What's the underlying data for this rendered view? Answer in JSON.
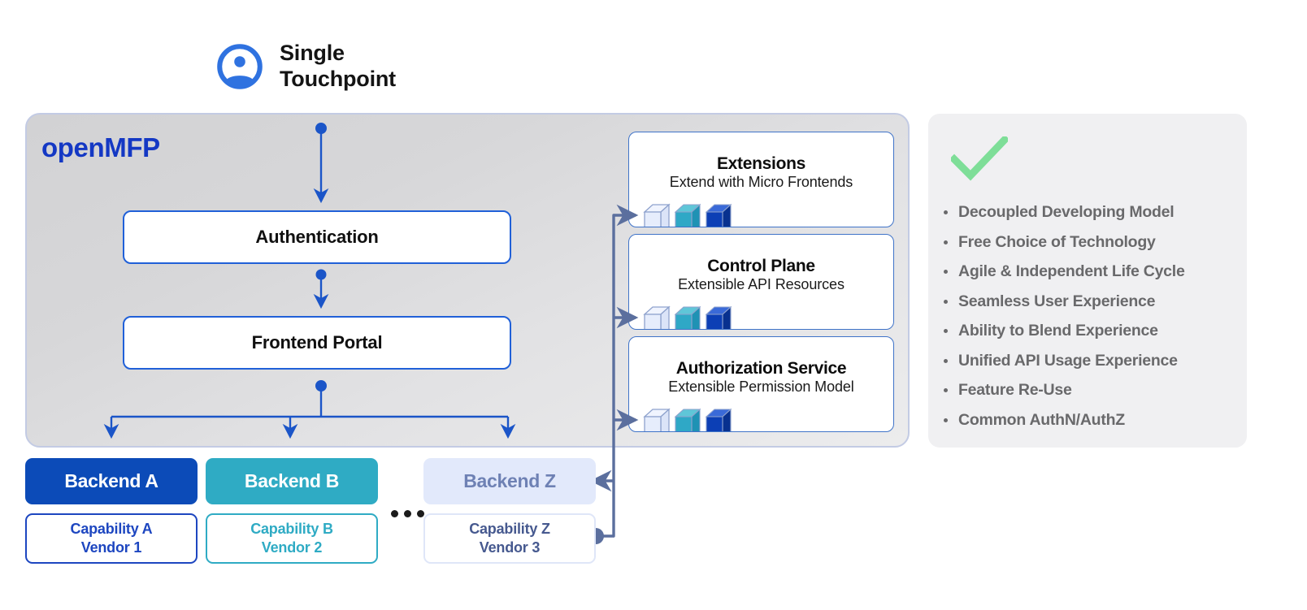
{
  "touchpoint": {
    "icon": "user-circle-icon",
    "label": "Single\nTouchpoint"
  },
  "platform": {
    "title": "openMFP",
    "boxes": [
      {
        "label": "Authentication"
      },
      {
        "label": "Frontend Portal"
      }
    ],
    "cards": [
      {
        "title": "Extensions",
        "subtitle": "Extend with Micro Frontends"
      },
      {
        "title": "Control Plane",
        "subtitle": "Extensible API Resources"
      },
      {
        "title": "Authorization Service",
        "subtitle": "Extensible Permission Model"
      }
    ]
  },
  "backends": [
    {
      "name": "Backend A",
      "capability": "Capability A\nVendor 1"
    },
    {
      "name": "Backend B",
      "capability": "Capability B\nVendor 2"
    },
    {
      "name": "Backend Z",
      "capability": "Capability Z\nVendor 3"
    }
  ],
  "ellipsis": "•••",
  "benefits": {
    "icon": "green-check-icon",
    "items": [
      "Decoupled Developing Model",
      "Free Choice of Technology",
      "Agile & Independent Life Cycle",
      "Seamless User Experience",
      "Ability to Blend Experience",
      "Unified API Usage Experience",
      "Feature Re-Use",
      "Common AuthN/AuthZ"
    ]
  },
  "colors": {
    "brand_blue": "#1438c4",
    "arrow_blue": "#1b55c8",
    "connector_slate": "#5b6f9e",
    "backend_a": "#0c4bb8",
    "backend_b": "#2fabc4",
    "backend_z_bg": "#e2e9fb",
    "backend_z_text": "#6e81b4",
    "check_green": "#7ede98",
    "panel_gray": "#f0f0f2",
    "cube_light": "#e3eafb",
    "cube_teal": "#2fa8c6",
    "cube_dark": "#0c3fb5"
  }
}
